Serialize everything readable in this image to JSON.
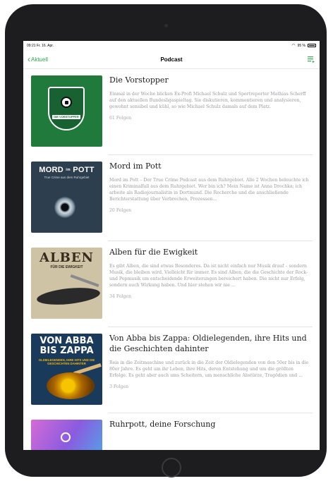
{
  "status_bar": {
    "left": "09:21  Fr. 16. Apr.",
    "battery": "95 %"
  },
  "nav": {
    "back_label": "Aktuell",
    "title": "Podcast"
  },
  "podcasts": [
    {
      "title": "Die Vorstopper",
      "description": "Einmal in der Woche blicken Ex-Profi Michael Schulz und Sportreporter Mathias Scherff auf den aktuellen Bundesligaspieltag. Sie diskutieren, kommentieren und analysieren, gewohnt sensibel und kühl, so wie Michael Schulz damals auf dem Platz.",
      "count": "61 Folgen",
      "art_label": "DIE VORSTOPPER"
    },
    {
      "title": "Mord im Pott",
      "description": "Mord im Pott – Der True Crime Podcast aus dem Ruhrgebiet. Alle 2 Wochen beleuchte ich einen Kriminalfall aus dem Ruhrgebiet. Wer bin ich? Mein Name ist Anna Drochka; ich arbeite als Radiojournalistin in Dortmund. Die Recherche und die anschließende Berichterstattung über Verbrechen, Prozessen...",
      "count": "20 Folgen",
      "art_title": "MORD",
      "art_small": "im",
      "art_title2": "POTT",
      "art_sub": "True Crime aus dem Ruhrgebiet"
    },
    {
      "title": "Alben für die Ewigkeit",
      "description": "Es gibt Alben, die sind etwas Besonderes. Da ist nicht einfach nur Musik drauf – sondern Musik, die bleiben wird. Vielleicht für immer. Es sind Alben, die die Geschichte der Rock- und Popmusik um entscheidende Erweiterungen bereichert haben. Die nicht nur Erfolg, sondern auch Wirkung haben. Und hier stehen wir nie ...",
      "count": "34 Folgen",
      "art_title": "ALBEN",
      "art_sub": "FÜR DIE EWIGKEIT"
    },
    {
      "title": "Von Abba bis Zappa: Oldielegenden, ihre Hits und die Geschichten dahinter",
      "description": "Reis in die Zeitmaschine und zurück in die Zeit der Oldielegenden von den 50er bis in die 80er Jahre. Es geht um ihr Leben, ihre Hits, deren Entstehung und um die größten Erfolge. Es geht aber auch ums Scheitern, um menschliche Abstürze, Tragödien und ...",
      "count": "3 Folgen",
      "art_title": "VON ABBA BIS ZAPPA",
      "art_sub": "OLDIELEGENDEN, IHRE HITS UND DIE GESCHICHTEN DAHINTER"
    },
    {
      "title": "Ruhrpott, deine Forschung",
      "description": "",
      "count": ""
    }
  ],
  "colors": {
    "accent": "#34a853",
    "device": "#1d1d1f"
  }
}
